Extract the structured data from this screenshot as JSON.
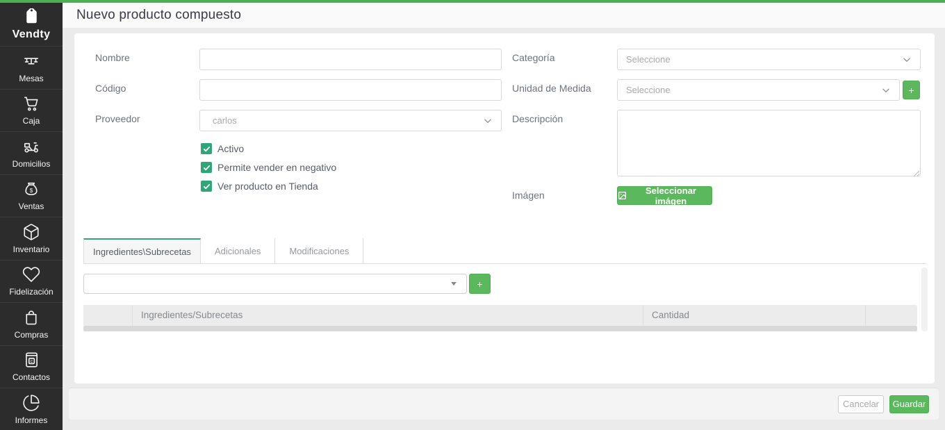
{
  "colors": {
    "topbar_green": "#4caf50",
    "accent_teal_green": "#2fa67a",
    "button_green": "#5cb85c",
    "sidebar_bg": "#2c2c2c"
  },
  "header": {
    "title": "Nuevo producto compuesto"
  },
  "sidebar": {
    "logo_text": "Vendty",
    "logo_icon": "tag-icon",
    "items": [
      {
        "label": "Mesas",
        "icon": "table-icon"
      },
      {
        "label": "Caja",
        "icon": "cart-icon"
      },
      {
        "label": "Domicilios",
        "icon": "scooter-icon"
      },
      {
        "label": "Ventas",
        "icon": "money-bag-icon"
      },
      {
        "label": "Inventario",
        "icon": "package-icon"
      },
      {
        "label": "Fidelización",
        "icon": "heart-icon"
      },
      {
        "label": "Compras",
        "icon": "shopping-bag-icon"
      },
      {
        "label": "Contactos",
        "icon": "contacts-book-icon"
      },
      {
        "label": "Informes",
        "icon": "pie-chart-icon"
      }
    ]
  },
  "form": {
    "nombre": {
      "label": "Nombre",
      "value": ""
    },
    "codigo": {
      "label": "Código",
      "value": ""
    },
    "proveedor": {
      "label": "Proveedor",
      "value": "carlos",
      "icon": "chevron-down-icon"
    },
    "checkboxes": [
      {
        "label": "Activo",
        "checked": true
      },
      {
        "label": "Permite vender en negativo",
        "checked": true
      },
      {
        "label": "Ver producto en Tienda",
        "checked": true
      }
    ],
    "categoria": {
      "label": "Categoría",
      "value": "Seleccione",
      "icon": "chevron-down-icon"
    },
    "unidad": {
      "label": "Unidad de Medida",
      "value": "Seleccione",
      "icon": "chevron-down-icon",
      "add_label": "+"
    },
    "descripcion": {
      "label": "Descripción",
      "value": ""
    },
    "imagen": {
      "label": "Imágen",
      "button_label": "Seleccionar imágen",
      "button_icon": "image-icon"
    }
  },
  "tabs": [
    {
      "label": "Ingredientes\\Subrecetas",
      "active": true
    },
    {
      "label": "Adicionales",
      "active": false
    },
    {
      "label": "Modificaciones",
      "active": false
    }
  ],
  "ingredients": {
    "selector_value": "",
    "add_label": "+",
    "table": {
      "headers": [
        "",
        "Ingredientes/Subrecetas",
        "Cantidad",
        ""
      ],
      "rows": []
    }
  },
  "footer": {
    "cancel_label": "Cancelar",
    "save_label": "Guardar"
  }
}
